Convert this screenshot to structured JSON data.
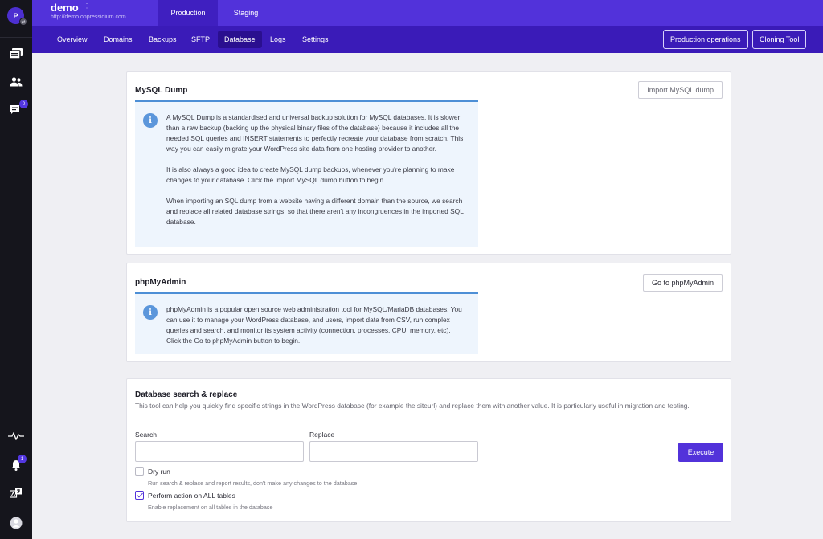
{
  "sidebar": {
    "avatar_initial": "P",
    "avatar_mini_glyph": "⇄",
    "icons": [
      "sites-icon",
      "users-icon",
      "tickets-icon",
      "activity-icon",
      "bell-icon",
      "translate-icon",
      "user-avatar-icon"
    ],
    "tickets_badge": "0",
    "notifications_badge": "1"
  },
  "header": {
    "site_name": "demo",
    "site_url": "http://demo.onpressidium.com",
    "environments": [
      "Production",
      "Staging"
    ],
    "active_environment": "Production"
  },
  "nav": {
    "items": [
      "Overview",
      "Domains",
      "Backups",
      "SFTP",
      "Database",
      "Logs",
      "Settings"
    ],
    "active": "Database",
    "production_operations_label": "Production operations",
    "cloning_tool_label": "Cloning Tool"
  },
  "mysql_dump": {
    "title": "MySQL Dump",
    "button_label": "Import MySQL dump",
    "paragraphs": [
      "A MySQL Dump is a standardised and universal backup solution for MySQL databases. It is slower than a raw backup (backing up the physical binary files of the database) because it includes all the needed SQL queries and INSERT statements to perfectly recreate your database from scratch. This way you can easily migrate your WordPress site data from one hosting provider to another.",
      "It is also always a good idea to create MySQL dump backups, whenever you're planning to make changes to your database. Click the Import MySQL dump button to begin.",
      "When importing an SQL dump from a website having a different domain than the source, we search and replace all related database strings, so that there aren't any incongruences in the imported SQL database."
    ]
  },
  "phpmyadmin": {
    "title": "phpMyAdmin",
    "button_label": "Go to phpMyAdmin",
    "paragraph": "phpMyAdmin is a popular open source web administration tool for MySQL/MariaDB databases. You can use it to manage your WordPress database, and users, import data from CSV, run complex queries and search, and monitor its system activity (connection, processes, CPU, memory, etc). Click the Go to phpMyAdmin button to begin."
  },
  "search_replace": {
    "title": "Database search & replace",
    "description": "This tool can help you quickly find specific strings in the WordPress database (for example the siteurl) and replace them with another value. It is particularly useful in migration and testing.",
    "search_label": "Search",
    "search_value": "",
    "replace_label": "Replace",
    "replace_value": "",
    "execute_label": "Execute",
    "dry_run_label": "Dry run",
    "dry_run_help": "Run search & replace and report results, don't make any changes to the database",
    "dry_run_checked": false,
    "all_tables_label": "Perform action on ALL tables",
    "all_tables_help": "Enable replacement on all tables in the database",
    "all_tables_checked": true
  },
  "colors": {
    "brand": "#5232da",
    "subnav": "#3a1bb8",
    "sidebar": "#15151c",
    "info_background": "#eef5fd",
    "info_accent": "#4d8fd6"
  }
}
